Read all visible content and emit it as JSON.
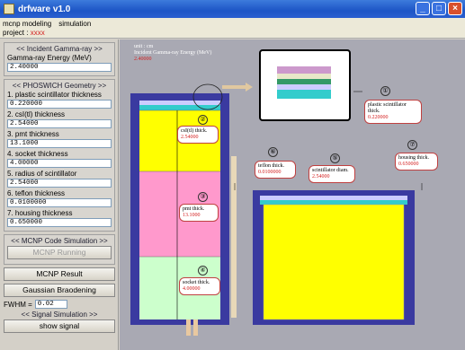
{
  "window": {
    "title": "drfware v1.0"
  },
  "menu": {
    "items": [
      "mcnp modeling",
      "simulation"
    ]
  },
  "project": {
    "label": "project :",
    "value": "xxxx"
  },
  "panel": {
    "incident": {
      "title": "<< Incident Gamma-ray >>",
      "energy_label": "Gamma-ray Energy (MeV)",
      "energy_value": "2.40000"
    },
    "geometry": {
      "title": "<< PHOSWICH Geometry >>",
      "fields": [
        {
          "label": "1. plastic scintillator thickness",
          "value": "0.220000"
        },
        {
          "label": "2. csI(tl) thickness",
          "value": "2.54000"
        },
        {
          "label": "3. pmt thickness",
          "value": "13.1000"
        },
        {
          "label": "4. socket thickness",
          "value": "4.00000"
        },
        {
          "label": "5. radius of scintillator",
          "value": "2.54000"
        },
        {
          "label": "6. teflon thickness",
          "value": "0.0100000"
        },
        {
          "label": "7. housing thickness",
          "value": "0.650000"
        }
      ]
    },
    "mcnp_title": "<< MCNP Code Simulation >>",
    "mcnp_running": "MCNP Running",
    "mcnp_result": "MCNP Result",
    "gaussian": "Gaussian Braodening",
    "fwhm_label": "FWHM =",
    "fwhm_value": "0.02",
    "signal_title": "<< Signal Simulation >>",
    "show_signal": "show signal"
  },
  "canvas": {
    "header_small": "unit : cm",
    "energy_label": "Incident Gamma-ray Energy (MeV)",
    "energy_value": "2.40000",
    "callouts": {
      "csi": {
        "num": "②",
        "label": "csI(tl) thick.",
        "value": "2.54000"
      },
      "pmt": {
        "num": "③",
        "label": "pmt thick.",
        "value": "13.1000"
      },
      "socket": {
        "num": "④",
        "label": "socket thick.",
        "value": "4.00000"
      },
      "plastic": {
        "num": "①",
        "label": "plastic scintillator thick.",
        "value": "0.220000"
      },
      "teflon": {
        "num": "⑥",
        "label": "teflon thick.",
        "value": "0.0100000"
      },
      "diam": {
        "num": "⑤",
        "label": "scintillator diam.",
        "value": "2.54000"
      },
      "housing": {
        "num": "⑦",
        "label": "housing thick.",
        "value": "0.650000"
      }
    }
  },
  "colors": {
    "housing": "#3a3aa0",
    "csi": "#ffff00",
    "pmt": "#ff99cc",
    "socket": "#ccffcc",
    "plastic": "#33cccc",
    "teflon": "#ccccff"
  }
}
